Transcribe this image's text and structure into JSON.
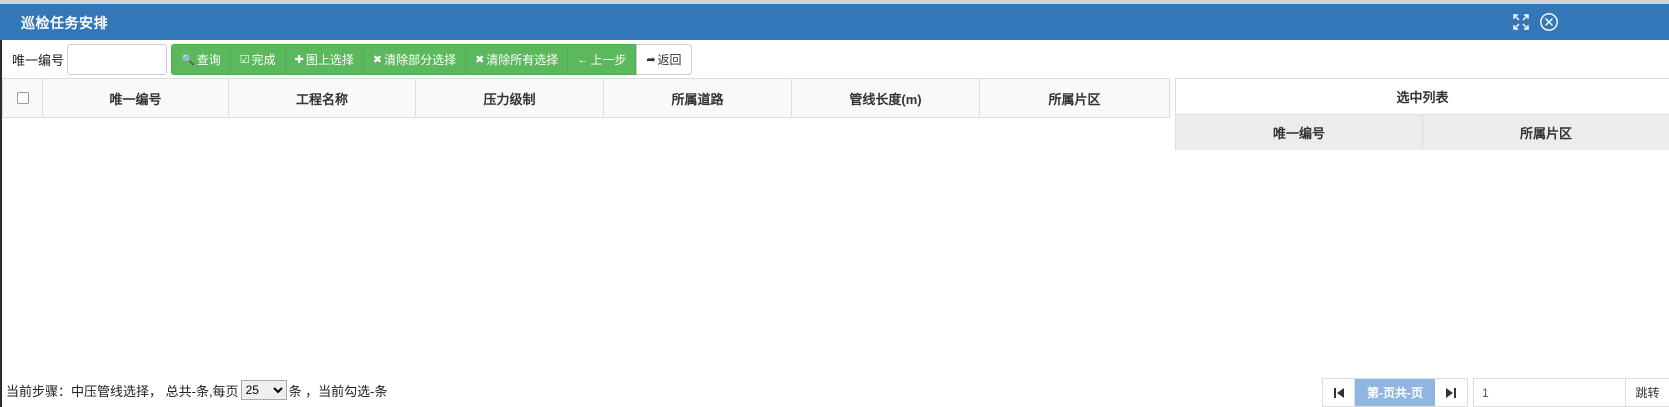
{
  "window": {
    "title": "巡检任务安排",
    "maximize_icon": "maximize-icon",
    "close_icon": "close-circle-icon"
  },
  "toolbar": {
    "search_label": "唯一编号",
    "search_value": "",
    "search_placeholder": "",
    "buttons": [
      {
        "icon": "search-icon",
        "glyph": "🔍",
        "label": "查询"
      },
      {
        "icon": "check-square-icon",
        "glyph": "☑",
        "label": "完成"
      },
      {
        "icon": "plus-icon",
        "glyph": "✚",
        "label": "图上选择"
      },
      {
        "icon": "x-icon",
        "glyph": "✖",
        "label": "清除部分选择"
      },
      {
        "icon": "x-icon",
        "glyph": "✖",
        "label": "清除所有选择"
      },
      {
        "icon": "arrow-left-icon",
        "glyph": "←",
        "label": "上一步"
      },
      {
        "icon": "share-arrow-icon",
        "glyph": "➦",
        "label": "返回"
      }
    ]
  },
  "grid": {
    "columns": [
      "唯一编号",
      "工程名称",
      "压力级制",
      "所属道路",
      "管线长度(m)",
      "所属片区"
    ]
  },
  "selected_list": {
    "title": "选中列表",
    "columns": [
      "唯一编号",
      "所属片区"
    ]
  },
  "status": {
    "prefix": "当前步骤：中压管线选择，  总共-条,每页",
    "page_size": "25",
    "page_size_options": [
      "25"
    ],
    "suffix": "条 ，当前勾选-条"
  },
  "pager": {
    "first_icon": "first-page-icon",
    "last_icon": "last-page-icon",
    "current_label": "第-页共-页",
    "jump_value": "1",
    "jump_button": "跳转"
  },
  "colors": {
    "titlebar": "#3477b9",
    "button_green": "#5cb85c",
    "pager_active": "#8fb5e0"
  }
}
